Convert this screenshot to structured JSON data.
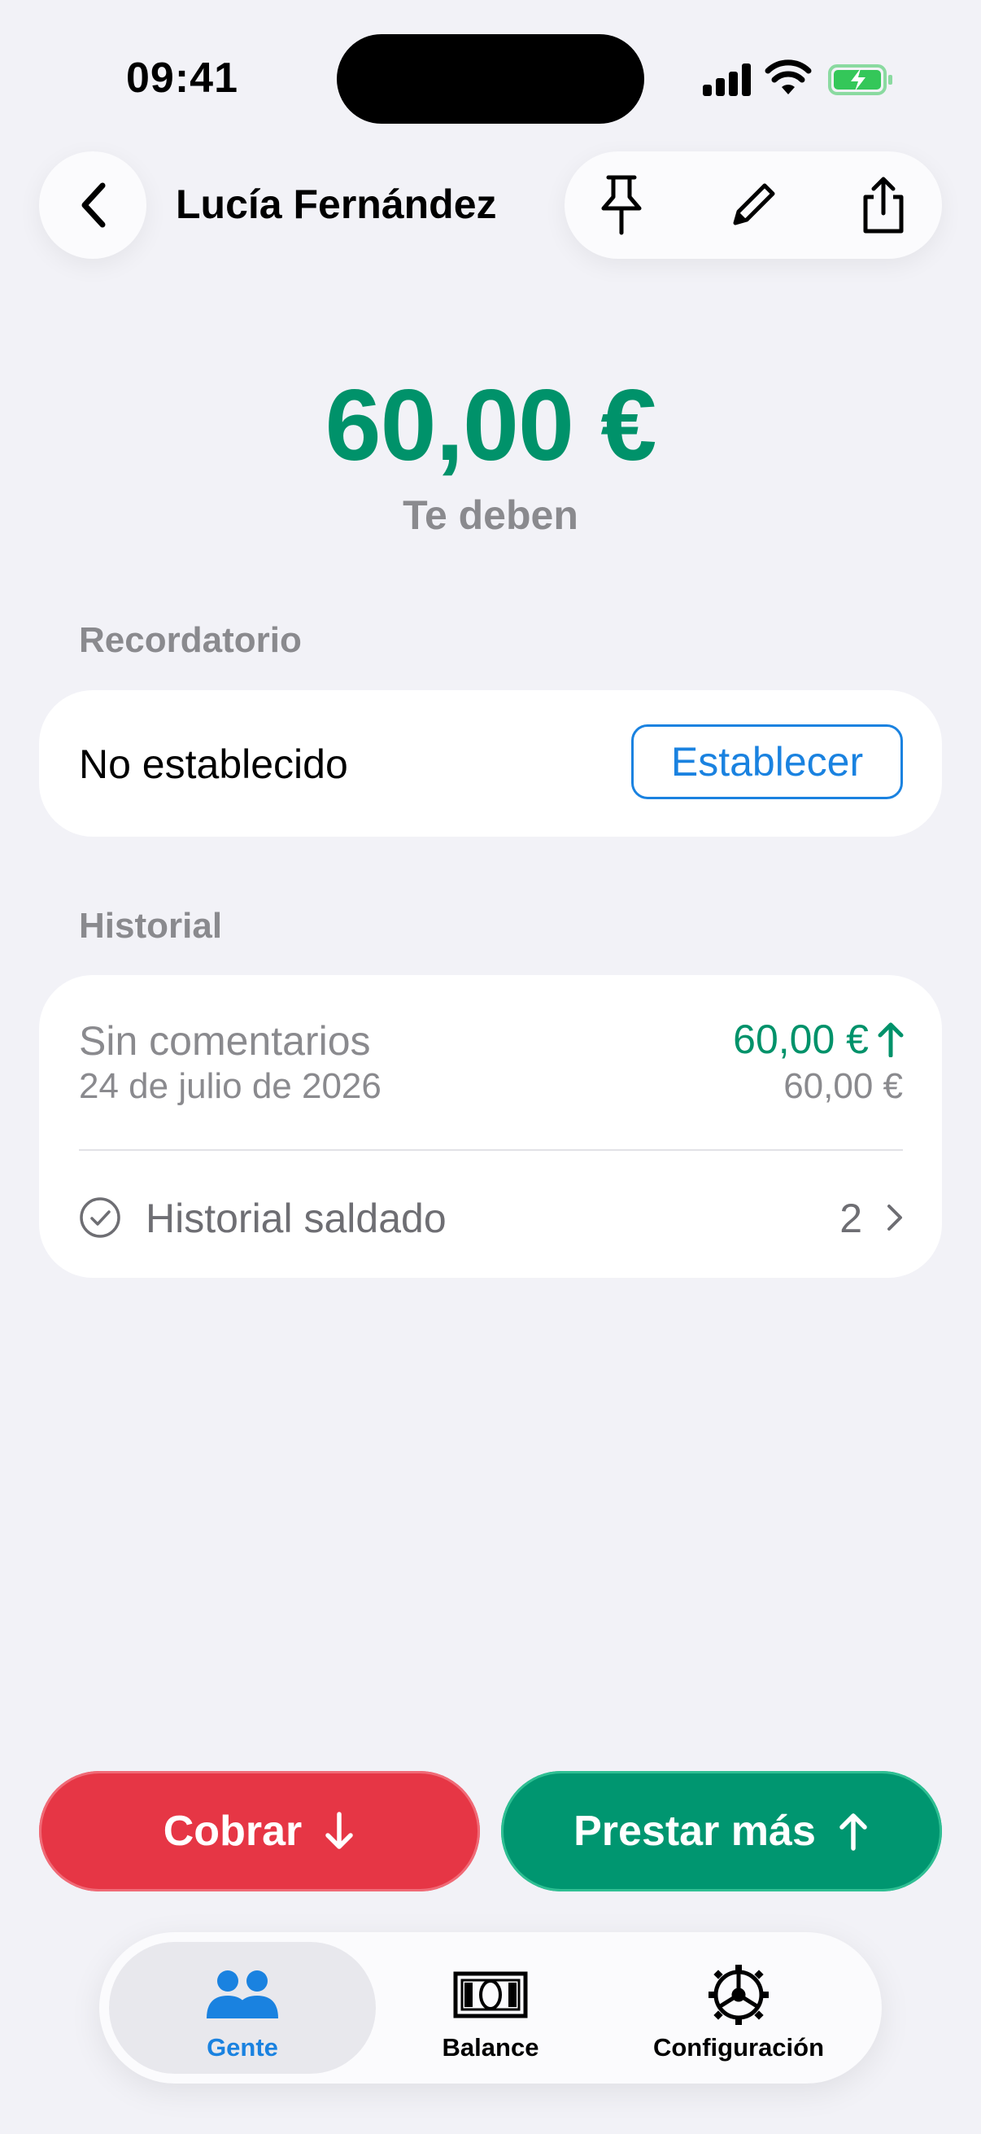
{
  "status_bar": {
    "time": "09:41"
  },
  "header": {
    "contact_name": "Lucía Fernández",
    "icons": [
      "chevron-left-icon",
      "pin-icon",
      "pencil-icon",
      "share-icon"
    ]
  },
  "balance": {
    "amount": "60,00 €",
    "caption": "Te deben"
  },
  "reminder": {
    "section_title": "Recordatorio",
    "status": "No establecido",
    "button_label": "Establecer"
  },
  "history": {
    "section_title": "Historial",
    "entries": [
      {
        "comment": "Sin comentarios",
        "date": "24 de julio de 2026",
        "amount": "60,00 €",
        "balance": "60,00 €"
      }
    ],
    "settled": {
      "label": "Historial saldado",
      "count": "2"
    }
  },
  "actions": {
    "collect_label": "Cobrar",
    "lend_label": "Prestar más"
  },
  "tabs": [
    {
      "label": "Gente",
      "icon": "people-icon",
      "active": true
    },
    {
      "label": "Balance",
      "icon": "banknote-icon",
      "active": false
    },
    {
      "label": "Configuración",
      "icon": "gear-icon",
      "active": false
    }
  ],
  "colors": {
    "positive": "#00926a",
    "accent": "#1a82e0",
    "collect": "#e63645",
    "lend": "#009670",
    "background": "#f2f2f7"
  }
}
